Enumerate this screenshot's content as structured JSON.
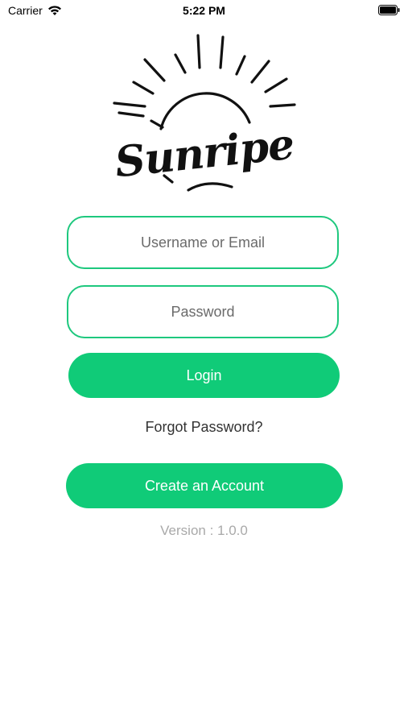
{
  "status_bar": {
    "carrier": "Carrier",
    "time": "5:22 PM"
  },
  "logo": {
    "text": "Sunripe"
  },
  "form": {
    "username_placeholder": "Username or Email",
    "password_placeholder": "Password",
    "login_label": "Login",
    "forgot_label": "Forgot Password?",
    "create_label": "Create an Account"
  },
  "footer": {
    "version": "Version : 1.0.0"
  },
  "colors": {
    "accent": "#10cb78",
    "field_border": "#1ec87e",
    "version_text": "#a9a9a9"
  },
  "icons": {
    "wifi": "wifi-icon",
    "battery": "battery-icon"
  }
}
